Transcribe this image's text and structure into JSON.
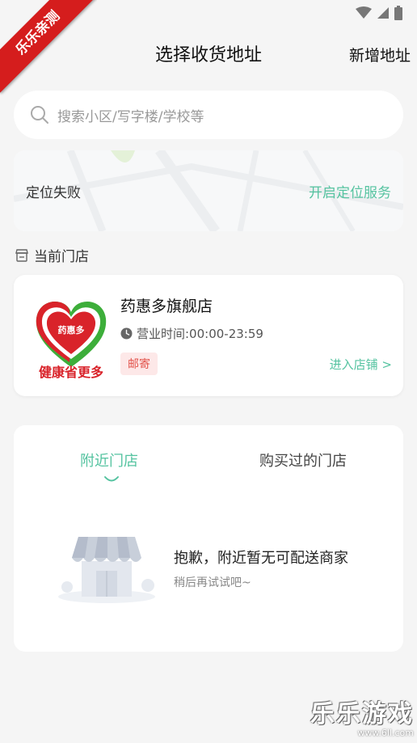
{
  "corner_ribbon": "乐乐亲测",
  "header": {
    "title": "选择收货地址",
    "add_address": "新增地址"
  },
  "search": {
    "placeholder": "搜索小区/写字楼/学校等"
  },
  "location": {
    "status": "定位失败",
    "action": "开启定位服务"
  },
  "current_store": {
    "section_label": "当前门店",
    "name": "药惠多旗舰店",
    "hours": "营业时间:00:00-23:59",
    "tag": "邮寄",
    "enter_label": "进入店铺 >",
    "logo_heart_text": "药惠多",
    "logo_slogan": "健康省更多"
  },
  "nearby": {
    "tabs": [
      "附近门店",
      "购买过的门店"
    ],
    "active_tab": 0,
    "empty_title": "抱歉，附近暂无可配送商家",
    "empty_subtitle": "稍后再试试吧~"
  },
  "watermark": {
    "main": "乐乐游戏",
    "url": "www.6ll.com"
  },
  "colors": {
    "accent": "#55c3a0",
    "tag_bg": "#fde8e8",
    "tag_text": "#e2524a",
    "ribbon": "#d51d1d",
    "logo_red": "#d9232a",
    "logo_green": "#3dae3a"
  }
}
